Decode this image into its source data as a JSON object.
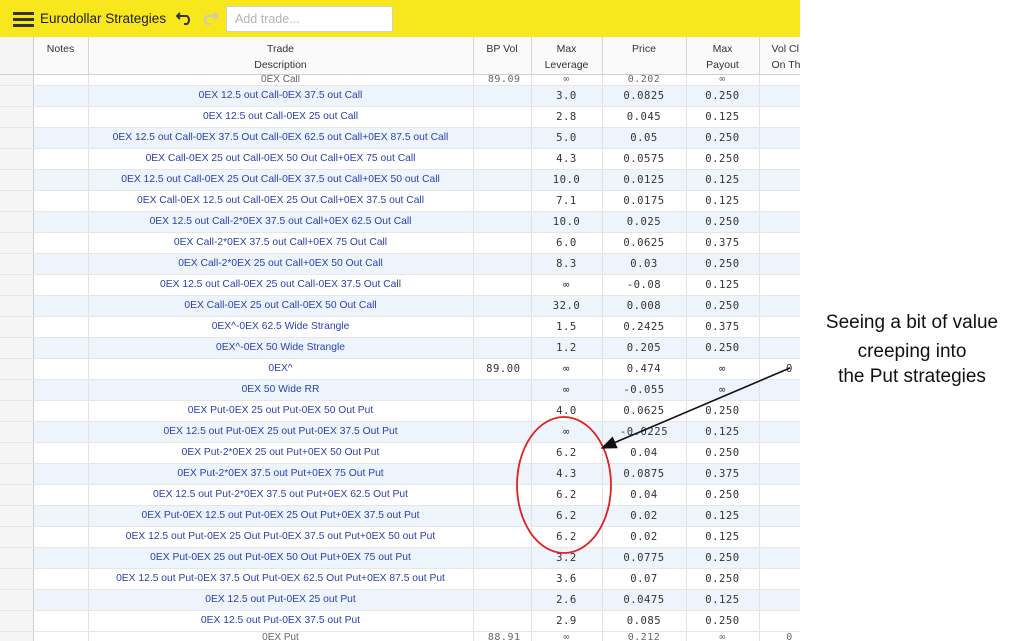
{
  "app": {
    "title": "Eurodollar Strategies",
    "add_trade_placeholder": "Add trade..."
  },
  "icons": {
    "menu": "hamburger-menu-icon",
    "undo": "undo-icon",
    "redo": "redo-icon"
  },
  "colors": {
    "toolbar": "#f8e71c",
    "link_text": "#2a3fb0",
    "row_alt": "#eef4fc",
    "highlight_circle": "#e02020"
  },
  "columns": {
    "notes": "Notes",
    "trade_1": "Trade",
    "trade_2": "Description",
    "bp_vol": "BP Vol",
    "lev_1": "Max",
    "lev_2": "Leverage",
    "price": "Price",
    "payout_1": "Max",
    "payout_2": "Payout",
    "volch_1": "Vol Cl",
    "volch_2": "On Th"
  },
  "partial_top": {
    "desc": "0EX Call",
    "bp": "89.09",
    "lev": "∞",
    "price": "0.202",
    "payout": "∞"
  },
  "rows": [
    {
      "desc": "0EX 12.5 out Call-0EX 37.5 out Call",
      "bp": "",
      "lev": "3.0",
      "price": "0.0825",
      "payout": "0.250",
      "volch": ""
    },
    {
      "desc": "0EX 12.5 out Call-0EX 25 out Call",
      "bp": "",
      "lev": "2.8",
      "price": "0.045",
      "payout": "0.125",
      "volch": ""
    },
    {
      "desc": "0EX 12.5 out Call-0EX 37.5 Out Call-0EX 62.5 out Call+0EX 87.5 out Call",
      "bp": "",
      "lev": "5.0",
      "price": "0.05",
      "payout": "0.250",
      "volch": ""
    },
    {
      "desc": "0EX Call-0EX 25 out Call-0EX 50 Out Call+0EX 75 out Call",
      "bp": "",
      "lev": "4.3",
      "price": "0.0575",
      "payout": "0.250",
      "volch": ""
    },
    {
      "desc": "0EX 12.5 out Call-0EX 25 Out Call-0EX 37.5 out Call+0EX 50 out Call",
      "bp": "",
      "lev": "10.0",
      "price": "0.0125",
      "payout": "0.125",
      "volch": ""
    },
    {
      "desc": "0EX Call-0EX 12.5 out Call-0EX 25 Out Call+0EX 37.5 out Call",
      "bp": "",
      "lev": "7.1",
      "price": "0.0175",
      "payout": "0.125",
      "volch": ""
    },
    {
      "desc": "0EX 12.5 out Call-2*0EX 37.5 out Call+0EX 62.5 Out Call",
      "bp": "",
      "lev": "10.0",
      "price": "0.025",
      "payout": "0.250",
      "volch": ""
    },
    {
      "desc": "0EX Call-2*0EX 37.5 out Call+0EX 75 Out Call",
      "bp": "",
      "lev": "6.0",
      "price": "0.0625",
      "payout": "0.375",
      "volch": ""
    },
    {
      "desc": "0EX Call-2*0EX 25 out Call+0EX 50 Out Call",
      "bp": "",
      "lev": "8.3",
      "price": "0.03",
      "payout": "0.250",
      "volch": ""
    },
    {
      "desc": "0EX 12.5 out Call-0EX 25 out Call-0EX 37.5 Out Call",
      "bp": "",
      "lev": "∞",
      "price": "-0.08",
      "payout": "0.125",
      "volch": ""
    },
    {
      "desc": "0EX Call-0EX 25 out Call-0EX 50 Out Call",
      "bp": "",
      "lev": "32.0",
      "price": "0.008",
      "payout": "0.250",
      "volch": ""
    },
    {
      "desc": "0EX^-0EX 62.5 Wide Strangle",
      "bp": "",
      "lev": "1.5",
      "price": "0.2425",
      "payout": "0.375",
      "volch": ""
    },
    {
      "desc": "0EX^-0EX 50 Wide Strangle",
      "bp": "",
      "lev": "1.2",
      "price": "0.205",
      "payout": "0.250",
      "volch": ""
    },
    {
      "desc": "0EX^",
      "bp": "89.00",
      "lev": "∞",
      "price": "0.474",
      "payout": "∞",
      "volch": "0"
    },
    {
      "desc": "0EX 50 Wide RR",
      "bp": "",
      "lev": "∞",
      "price": "-0.055",
      "payout": "∞",
      "volch": ""
    },
    {
      "desc": "0EX Put-0EX 25 out Put-0EX 50 Out Put",
      "bp": "",
      "lev": "4.0",
      "price": "0.0625",
      "payout": "0.250",
      "volch": ""
    },
    {
      "desc": "0EX 12.5 out Put-0EX 25 out Put-0EX 37.5 Out Put",
      "bp": "",
      "lev": "∞",
      "price": "-0.0225",
      "payout": "0.125",
      "volch": ""
    },
    {
      "desc": "0EX Put-2*0EX 25 out Put+0EX 50 Out Put",
      "bp": "",
      "lev": "6.2",
      "price": "0.04",
      "payout": "0.250",
      "volch": ""
    },
    {
      "desc": "0EX Put-2*0EX 37.5 out Put+0EX 75 Out Put",
      "bp": "",
      "lev": "4.3",
      "price": "0.0875",
      "payout": "0.375",
      "volch": ""
    },
    {
      "desc": "0EX 12.5 out Put-2*0EX 37.5 out Put+0EX 62.5 Out Put",
      "bp": "",
      "lev": "6.2",
      "price": "0.04",
      "payout": "0.250",
      "volch": ""
    },
    {
      "desc": "0EX Put-0EX 12.5 out Put-0EX 25 Out Put+0EX 37.5 out Put",
      "bp": "",
      "lev": "6.2",
      "price": "0.02",
      "payout": "0.125",
      "volch": ""
    },
    {
      "desc": "0EX 12.5 out Put-0EX 25 Out Put-0EX 37.5 out Put+0EX 50 out Put",
      "bp": "",
      "lev": "6.2",
      "price": "0.02",
      "payout": "0.125",
      "volch": ""
    },
    {
      "desc": "0EX Put-0EX 25 out Put-0EX 50 Out Put+0EX 75 out Put",
      "bp": "",
      "lev": "3.2",
      "price": "0.0775",
      "payout": "0.250",
      "volch": ""
    },
    {
      "desc": "0EX 12.5 out Put-0EX 37.5 Out Put-0EX 62.5 Out Put+0EX 87.5 out Put",
      "bp": "",
      "lev": "3.6",
      "price": "0.07",
      "payout": "0.250",
      "volch": ""
    },
    {
      "desc": "0EX 12.5 out Put-0EX 25 out Put",
      "bp": "",
      "lev": "2.6",
      "price": "0.0475",
      "payout": "0.125",
      "volch": ""
    },
    {
      "desc": "0EX 12.5 out Put-0EX 37.5 out Put",
      "bp": "",
      "lev": "2.9",
      "price": "0.085",
      "payout": "0.250",
      "volch": ""
    }
  ],
  "partial_bottom": {
    "desc": "0EX Put",
    "bp": "88.91",
    "lev": "∞",
    "price": "0.212",
    "payout": "∞",
    "volch": "0"
  },
  "annotation": {
    "line1": "Seeing a bit of value",
    "line2": "creeping into",
    "line3": "the Put strategies"
  }
}
